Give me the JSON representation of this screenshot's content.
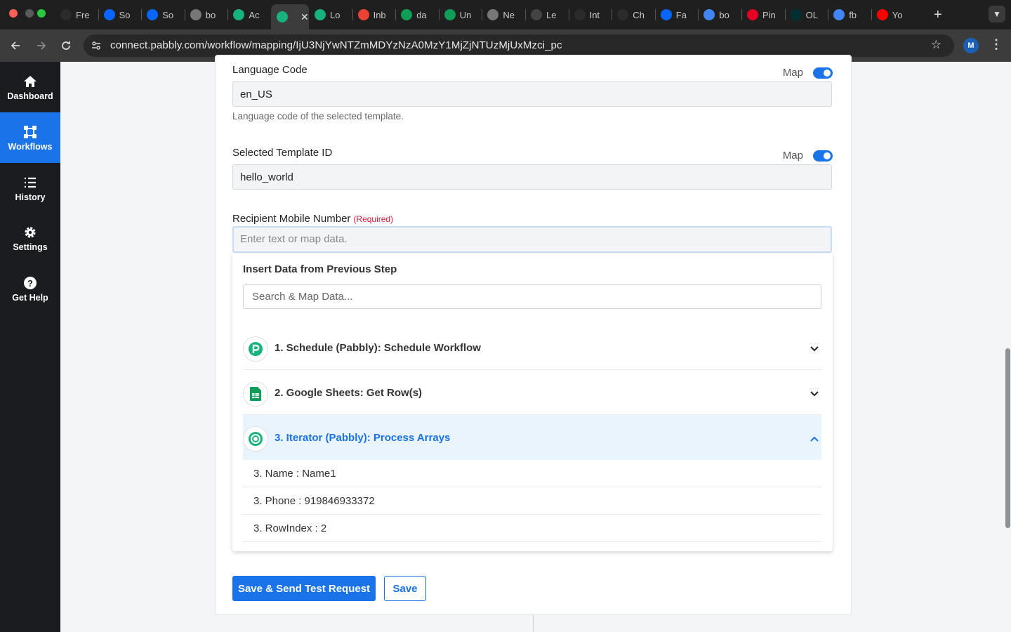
{
  "browser": {
    "tabs": [
      {
        "label": "Fre",
        "icon": "openai-icon",
        "color": "#2b2b2b"
      },
      {
        "label": "So",
        "icon": "meta-icon",
        "color": "#0866ff"
      },
      {
        "label": "So",
        "icon": "meta-icon",
        "color": "#0866ff"
      },
      {
        "label": "bo",
        "icon": "globe-icon",
        "color": "#777777"
      },
      {
        "label": "Ac",
        "icon": "pabbly-icon",
        "color": "#18b27c"
      },
      {
        "label": "",
        "icon": "pabbly-icon",
        "color": "#18b27c",
        "active": true
      },
      {
        "label": "Lo",
        "icon": "pabbly-icon",
        "color": "#18b27c"
      },
      {
        "label": "Inb",
        "icon": "gmail-icon",
        "color": "#ea4335"
      },
      {
        "label": "da",
        "icon": "sheets-icon",
        "color": "#0f9d58"
      },
      {
        "label": "Un",
        "icon": "sheets-icon",
        "color": "#0f9d58"
      },
      {
        "label": "Ne",
        "icon": "chrome-icon",
        "color": "#777777"
      },
      {
        "label": "Le",
        "icon": "doc-icon",
        "color": "#444444"
      },
      {
        "label": "Int",
        "icon": "openai-icon",
        "color": "#2b2b2b"
      },
      {
        "label": "Ch",
        "icon": "openai-icon",
        "color": "#2b2b2b"
      },
      {
        "label": "Fa",
        "icon": "meta-icon",
        "color": "#0866ff"
      },
      {
        "label": "bo",
        "icon": "google-icon",
        "color": "#4285f4"
      },
      {
        "label": "Pin",
        "icon": "pinterest-icon",
        "color": "#e60023"
      },
      {
        "label": "OL",
        "icon": "olx-icon",
        "color": "#002f34"
      },
      {
        "label": "fb",
        "icon": "google-icon",
        "color": "#4285f4"
      },
      {
        "label": "Yo",
        "icon": "youtube-icon",
        "color": "#ff0000"
      }
    ],
    "url": "connect.pabbly.com/workflow/mapping/IjU3NjYwNTZmMDYzNzA0MzY1MjZjNTUzMjUxMzci_pc",
    "profile_initial": "M"
  },
  "sidebar": {
    "items": [
      {
        "label": "Dashboard",
        "icon": "home-icon"
      },
      {
        "label": "Workflows",
        "icon": "workflows-icon",
        "active": true
      },
      {
        "label": "History",
        "icon": "history-list-icon"
      },
      {
        "label": "Settings",
        "icon": "gear-icon"
      },
      {
        "label": "Get Help",
        "icon": "help-icon"
      }
    ]
  },
  "form": {
    "language_code": {
      "label": "Language Code",
      "map_label": "Map",
      "value": "en_US",
      "helper": "Language code of the selected template."
    },
    "template_id": {
      "label": "Selected Template ID",
      "map_label": "Map",
      "value": "hello_world"
    },
    "recipient": {
      "label": "Recipient Mobile Number",
      "required_text": "(Required)",
      "placeholder": "Enter text or map data."
    }
  },
  "dropdown": {
    "title": "Insert Data from Previous Step",
    "search_placeholder": "Search & Map Data...",
    "steps": [
      {
        "label": "1. Schedule (Pabbly): Schedule Workflow",
        "icon": "pabbly-schedule-icon",
        "expanded": false
      },
      {
        "label": "2. Google Sheets: Get Row(s)",
        "icon": "google-sheets-icon",
        "expanded": false
      },
      {
        "label": "3. Iterator (Pabbly): Process Arrays",
        "icon": "iterator-icon",
        "expanded": true
      }
    ],
    "data_rows": [
      "3. Name : Name1",
      "3. Phone : 919846933372",
      "3. RowIndex : 2"
    ]
  },
  "actions": {
    "save_send_label": "Save & Send Test Request",
    "save_label": "Save"
  },
  "colors": {
    "accent": "#1a73e8",
    "sidebar_bg": "#1b1c20",
    "required": "#d6193a",
    "pabbly_green": "#18b27c"
  }
}
